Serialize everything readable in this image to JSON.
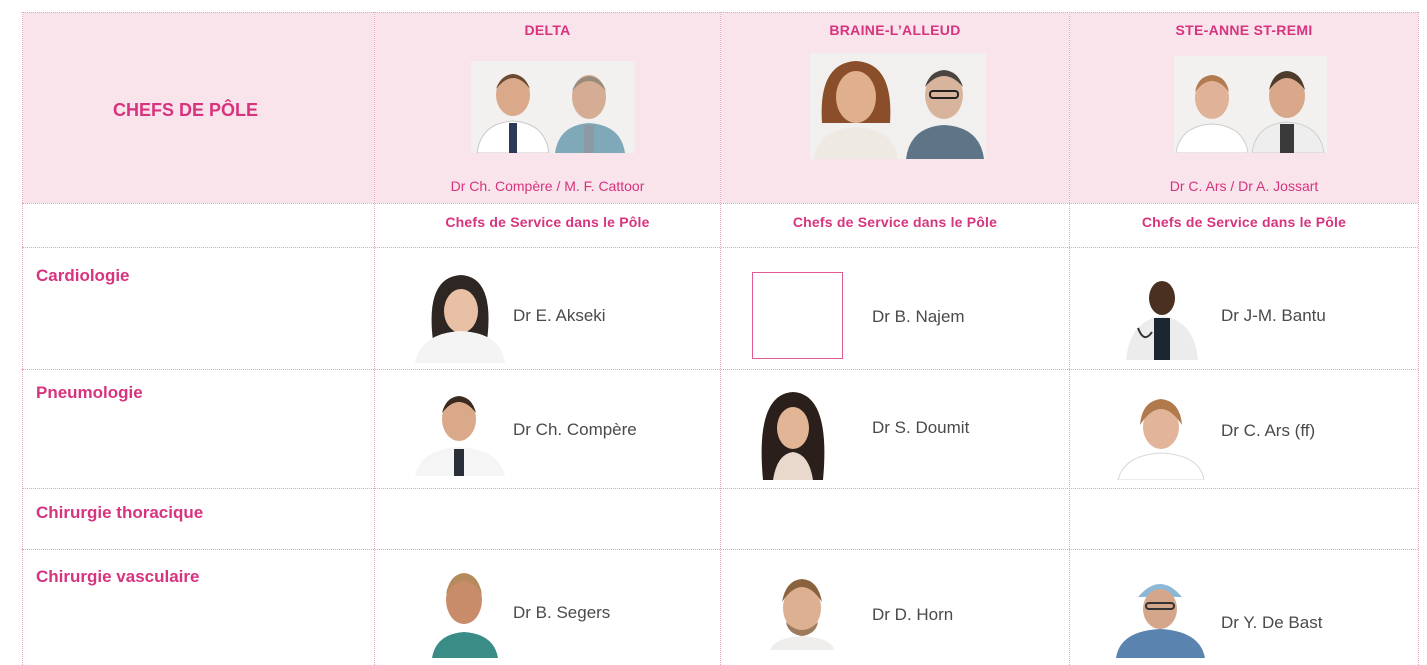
{
  "header": {
    "pole_title": "CHEFS DE PÔLE",
    "sites": [
      {
        "name": "DELTA",
        "chefs": "Dr Ch. Compère / M. F. Cattoor"
      },
      {
        "name": "BRAINE-L’ALLEUD",
        "chefs": ""
      },
      {
        "name": "STE-ANNE ST-REMI",
        "chefs": "Dr C. Ars / Dr A. Jossart"
      }
    ],
    "subheader": "Chefs de Service dans le Pôle"
  },
  "rows": [
    {
      "label": "Cardiologie",
      "doctors": [
        "Dr E. Akseki",
        "Dr B. Najem",
        "Dr J-M. Bantu"
      ]
    },
    {
      "label": "Pneumologie",
      "doctors": [
        "Dr Ch. Compère",
        "Dr S. Doumit",
        "Dr C. Ars (ff)"
      ]
    },
    {
      "label": "Chirurgie thoracique",
      "doctors": [
        "",
        "",
        ""
      ]
    },
    {
      "label": "Chirurgie vasculaire",
      "doctors": [
        "Dr B. Segers",
        "Dr D. Horn",
        "Dr Y. De Bast"
      ]
    }
  ],
  "colors": {
    "accent": "#d7337e",
    "header_bg": "#f9e4ec",
    "grid": "#e7a3bd"
  }
}
